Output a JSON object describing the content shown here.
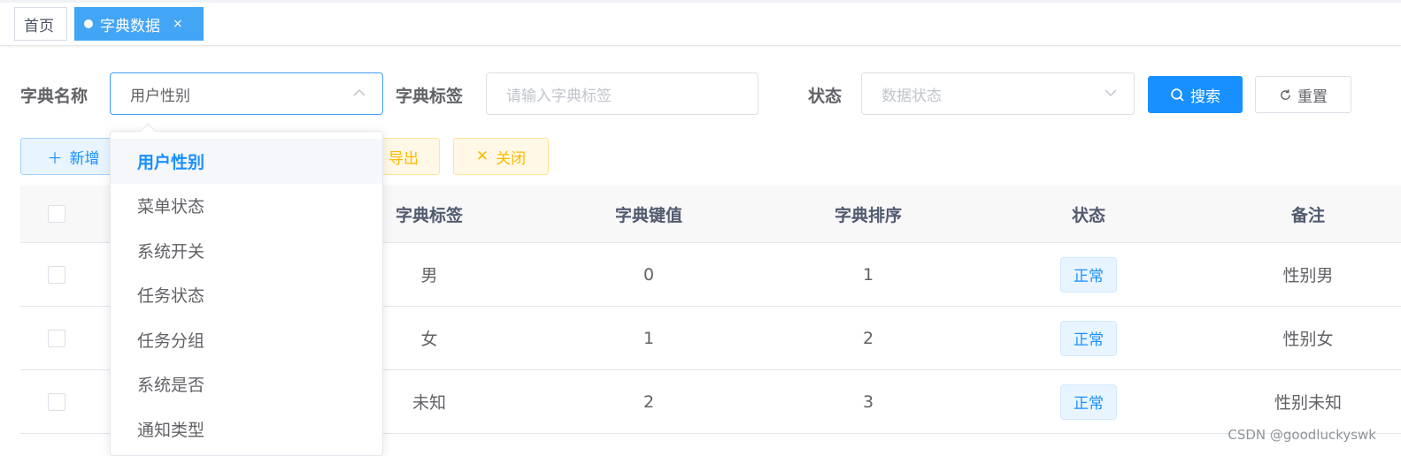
{
  "tabs": {
    "home": "首页",
    "active": "字典数据",
    "close": "×"
  },
  "search": {
    "dict_name_label": "字典名称",
    "dict_name_value": "用户性别",
    "dict_label_label": "字典标签",
    "dict_label_placeholder": "请输入字典标签",
    "status_label": "状态",
    "status_placeholder": "数据状态",
    "search_button": "搜索",
    "reset_button": "重置"
  },
  "toolbar": {
    "add": "新增",
    "export": "导出",
    "close": "关闭"
  },
  "table": {
    "headers": {
      "label": "字典标签",
      "value": "字典键值",
      "sort": "字典排序",
      "status": "状态",
      "remark": "备注"
    },
    "rows": [
      {
        "label": "男",
        "value": "0",
        "sort": "1",
        "status": "正常",
        "remark": "性别男"
      },
      {
        "label": "女",
        "value": "1",
        "sort": "2",
        "status": "正常",
        "remark": "性别女"
      },
      {
        "label": "未知",
        "value": "2",
        "sort": "3",
        "status": "正常",
        "remark": "性别未知"
      }
    ]
  },
  "dropdown": {
    "options": [
      "用户性别",
      "菜单状态",
      "系统开关",
      "任务状态",
      "任务分组",
      "系统是否",
      "通知类型"
    ],
    "selected_index": 0
  },
  "watermark": "CSDN @goodluckyswk",
  "colors": {
    "primary": "#1890ff",
    "tab_active": "#42a5f5",
    "warning": "#ffba00"
  }
}
